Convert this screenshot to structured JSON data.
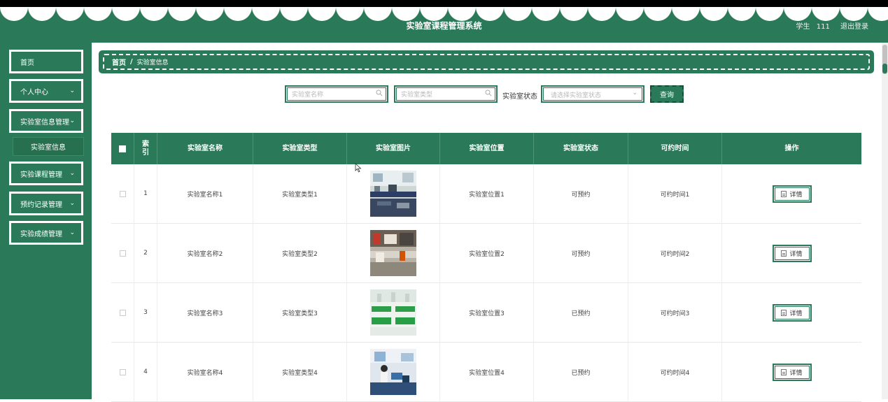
{
  "app": {
    "title": "实验室课程管理系统"
  },
  "user": {
    "role": "学生",
    "name": "111",
    "logout": "退出登录"
  },
  "colors": {
    "primary": "#2a7a5a",
    "white": "#ffffff"
  },
  "sidebar": {
    "items": [
      {
        "label": "首页",
        "has_chevron": false
      },
      {
        "label": "个人中心",
        "has_chevron": true
      },
      {
        "label": "实验室信息管理",
        "has_chevron": true,
        "expanded": true
      },
      {
        "label": "实验课程管理",
        "has_chevron": true
      },
      {
        "label": "预约记录管理",
        "has_chevron": true
      },
      {
        "label": "实验成绩管理",
        "has_chevron": true
      }
    ],
    "subitems": [
      {
        "label": "实验室信息",
        "parent": "实验室信息管理"
      }
    ]
  },
  "breadcrumb": {
    "home": "首页",
    "separator": "/",
    "current": "实验室信息"
  },
  "search": {
    "name_placeholder": "实验室名称",
    "type_placeholder": "实验室类型",
    "status_label": "实验室状态",
    "status_placeholder": "请选择实验室状态",
    "query_label": "查询"
  },
  "table": {
    "columns": [
      "",
      "索引",
      "实验室名称",
      "实验室类型",
      "实验室图片",
      "实验室位置",
      "实验室状态",
      "可约时间",
      "操作"
    ],
    "rows": [
      {
        "index": "1",
        "name": "实验室名称1",
        "type": "实验室类型1",
        "location": "实验室位置1",
        "status": "可预约",
        "time": "可约时间1",
        "action": "详情"
      },
      {
        "index": "2",
        "name": "实验室名称2",
        "type": "实验室类型2",
        "location": "实验室位置2",
        "status": "可预约",
        "time": "可约时间2",
        "action": "详情"
      },
      {
        "index": "3",
        "name": "实验室名称3",
        "type": "实验室类型3",
        "location": "实验室位置3",
        "status": "已预约",
        "time": "可约时间3",
        "action": "详情"
      },
      {
        "index": "4",
        "name": "实验室名称4",
        "type": "实验室类型4",
        "location": "实验室位置4",
        "status": "已预约",
        "time": "可约时间4",
        "action": "详情"
      }
    ]
  }
}
